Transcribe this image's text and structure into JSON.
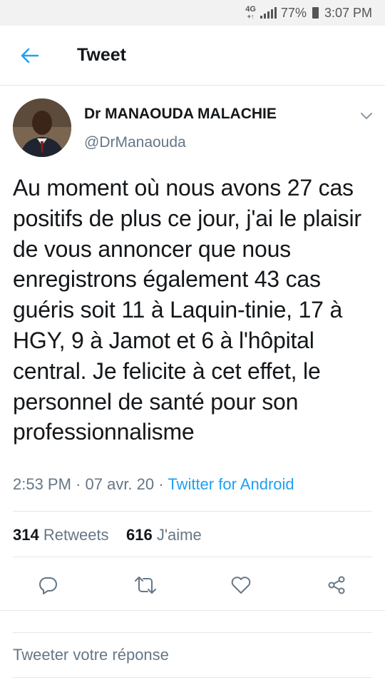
{
  "status_bar": {
    "network": "4G",
    "network_sub": "+↑",
    "battery": "77%",
    "time": "3:07 PM"
  },
  "app_bar": {
    "title": "Tweet",
    "back_icon": "arrow-left-icon"
  },
  "tweet": {
    "author_name": "Dr MANAOUDA MALACHIE",
    "author_handle": "@DrManaouda",
    "text": "Au moment où nous avons 27 cas positifs de plus ce jour, j'ai le plaisir de vous annoncer que nous enregistrons également 43 cas guéris soit 11 à Laquin-tinie, 17 à HGY, 9 à Jamot et 6 à l'hôpital central. Je felicite à cet effet, le personnel de santé pour son professionnalisme",
    "time": "2:53 PM",
    "date": "07 avr. 20",
    "separator": "·",
    "source": "Twitter for Android",
    "retweets_count": "314",
    "retweets_label": "Retweets",
    "likes_count": "616",
    "likes_label": "J'aime"
  },
  "actions": [
    {
      "name": "reply-icon"
    },
    {
      "name": "retweet-icon"
    },
    {
      "name": "like-icon"
    },
    {
      "name": "share-icon"
    }
  ],
  "reply": {
    "placeholder": "Tweeter votre réponse"
  },
  "colors": {
    "accent": "#1da1f2",
    "text": "#14171a",
    "secondary": "#657786",
    "border": "#e1e8ed"
  }
}
